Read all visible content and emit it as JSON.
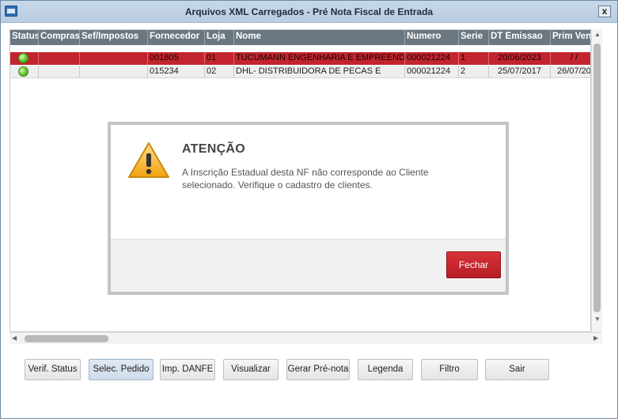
{
  "window": {
    "title": "Arquivos XML Carregados - Pré Nota Fiscal de Entrada",
    "close_label": "x"
  },
  "grid": {
    "columns": [
      "Status",
      "Compras",
      "Sef/Impostos",
      "Fornecedor",
      "Loja",
      "Nome",
      "Numero",
      "Serie",
      "DT Emissao",
      "Prim Venc"
    ],
    "rows": [
      {
        "status": "green",
        "compras": "",
        "sef": "",
        "fornecedor": "001805",
        "loja": "01",
        "nome": "TUCUMANN ENGENHARIA E EMPREEND",
        "numero": "000021224",
        "serie": "1",
        "dt_emissao": "20/06/2023",
        "prim_venc": "/ /"
      },
      {
        "status": "green",
        "compras": "",
        "sef": "",
        "fornecedor": "015234",
        "loja": "02",
        "nome": "DHL- DISTRIBUIDORA DE PECAS E",
        "numero": "000021224",
        "serie": "2",
        "dt_emissao": "25/07/2017",
        "prim_venc": "26/07/20"
      }
    ]
  },
  "toolbar": {
    "verif_status": "Verif. Status",
    "selec_pedido": "Selec. Pedido",
    "imp_danfe": "Imp. DANFE",
    "visualizar": "Visualizar",
    "gerar_prenota": "Gerar Pré-nota",
    "legenda": "Legenda",
    "filtro": "Filtro",
    "sair": "Sair"
  },
  "dialog": {
    "title": "ATENÇÃO",
    "message": "A Inscrição Estadual desta NF não corresponde ao Cliente selecionado. Verifique o cadastro de clientes.",
    "close_button": "Fechar",
    "icon": "warning-icon"
  },
  "colors": {
    "selected_row": "#c2252d",
    "dialog_button": "#c8262e",
    "header": "#6b7780"
  }
}
